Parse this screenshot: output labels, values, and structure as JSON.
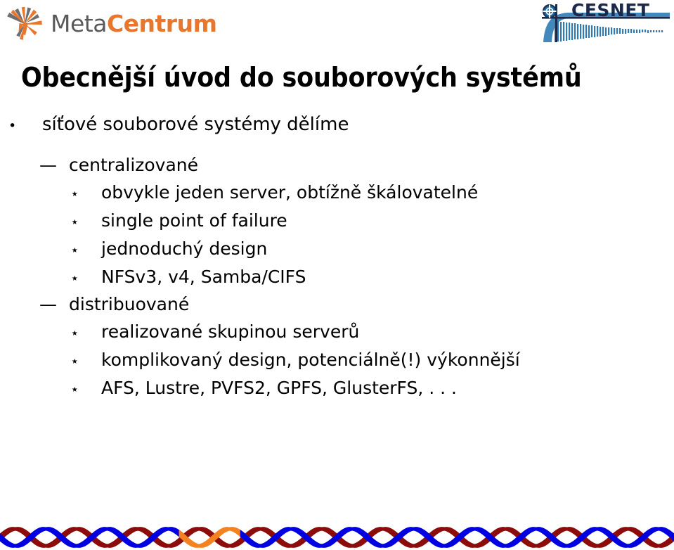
{
  "header": {
    "metacentrum_logo": {
      "icon": "starburst-icon",
      "text_part1": "Meta",
      "text_part2": "Centrum",
      "gray": "#58595B",
      "orange": "#E8762C"
    },
    "cesnet_logo": {
      "icon": "cesnet-emblem-icon",
      "text": "CESNET",
      "navy": "#1B2A4A",
      "blue": "#2E7BB5"
    }
  },
  "slide": {
    "title": "Obecnější úvod do souborových systémů",
    "bullets": [
      {
        "level": 1,
        "marker": "•",
        "marker_name": "bullet-dot-icon",
        "text": "síťové souborové systémy dělíme"
      },
      {
        "level": 2,
        "marker": "—",
        "marker_name": "bullet-dash-icon",
        "text": "centralizované"
      },
      {
        "level": 3,
        "marker": "⋆",
        "marker_name": "bullet-star-icon",
        "text": "obvykle jeden server, obtížně škálovatelné"
      },
      {
        "level": 3,
        "marker": "⋆",
        "marker_name": "bullet-star-icon",
        "text": "single point of failure"
      },
      {
        "level": 3,
        "marker": "⋆",
        "marker_name": "bullet-star-icon",
        "text": "jednoduchý design"
      },
      {
        "level": 3,
        "marker": "⋆",
        "marker_name": "bullet-star-icon",
        "text": "NFSv3, v4, Samba/CIFS"
      },
      {
        "level": 2,
        "marker": "—",
        "marker_name": "bullet-dash-icon",
        "text": "distribuované"
      },
      {
        "level": 3,
        "marker": "⋆",
        "marker_name": "bullet-star-icon",
        "text": "realizované skupinou serverů"
      },
      {
        "level": 3,
        "marker": "⋆",
        "marker_name": "bullet-star-icon",
        "text": "komplikovaný design, potenciálně(!) výkonnější"
      },
      {
        "level": 3,
        "marker": "⋆",
        "marker_name": "bullet-star-icon",
        "text": "AFS, Lustre, PVFS2, GPFS, GlusterFS, . . ."
      }
    ]
  },
  "footer": {
    "decoration": "braided-wave-ribbon",
    "colors": {
      "blue": "#0000E0",
      "dark_red": "#8C0B0B",
      "orange": "#F58220"
    },
    "wave_periods": 11,
    "orange_segment_index": 3
  }
}
